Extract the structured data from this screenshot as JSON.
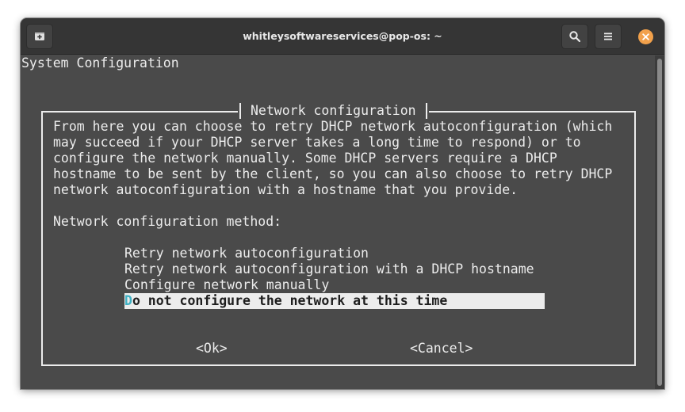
{
  "window": {
    "title": "whitleysoftwareservices@pop-os: ~"
  },
  "titlebar_icons": {
    "new_tab": "new-tab-icon",
    "search": "search-icon",
    "menu": "hamburger-menu-icon",
    "close": "close-icon"
  },
  "colors": {
    "terminal_bg": "#4a4a4a",
    "titlebar_bg": "#353535",
    "text": "#ececec",
    "close_button": "#f2a14b",
    "highlight_letter": "#3fb1c4"
  },
  "terminal": {
    "header": "System Configuration",
    "dialog": {
      "title": "Network configuration",
      "description_lines": [
        "From here you can choose to retry DHCP network autoconfiguration (which",
        "may succeed if your DHCP server takes a long time to respond) or to",
        "configure the network manually. Some DHCP servers require a DHCP",
        "hostname to be sent by the client, so you can also choose to retry DHCP",
        "network autoconfiguration with a hostname that you provide."
      ],
      "method_label": "Network configuration method:",
      "options": [
        "Retry network autoconfiguration",
        "Retry network autoconfiguration with a DHCP hostname",
        "Configure network manually",
        "Do not configure the network at this time"
      ],
      "selected_option_first_letter": "D",
      "selected_option_rest": "o not configure the network at this time",
      "ok_label": "<Ok>",
      "cancel_label": "<Cancel>"
    }
  }
}
